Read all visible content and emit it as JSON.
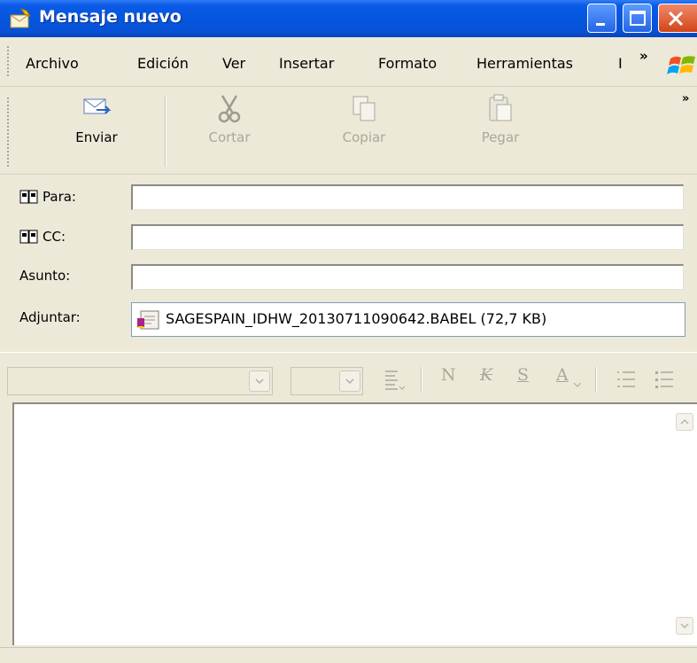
{
  "window": {
    "title": "Mensaje nuevo"
  },
  "menu": {
    "items": [
      "Archivo",
      "Edición",
      "Ver",
      "Insertar",
      "Formato",
      "Herramientas",
      "I"
    ],
    "more": "»"
  },
  "toolbar": {
    "send_label": "Enviar",
    "cut_label": "Cortar",
    "copy_label": "Copiar",
    "paste_label": "Pegar",
    "more": "»"
  },
  "fields": {
    "to_label": "Para:",
    "cc_label": "CC:",
    "subject_label": "Asunto:",
    "attach_label": "Adjuntar:",
    "to_value": "",
    "cc_value": "",
    "subject_value": "",
    "attachment": "SAGESPAIN_IDHW_20130711090642.BABEL (72,7 KB)"
  },
  "format_bar": {
    "bold": "N",
    "italic": "K",
    "underline": "S",
    "font_color": "A"
  },
  "colors": {
    "titlebar": "#0556de",
    "chrome": "#ece9d8",
    "close_button": "#d24418"
  }
}
